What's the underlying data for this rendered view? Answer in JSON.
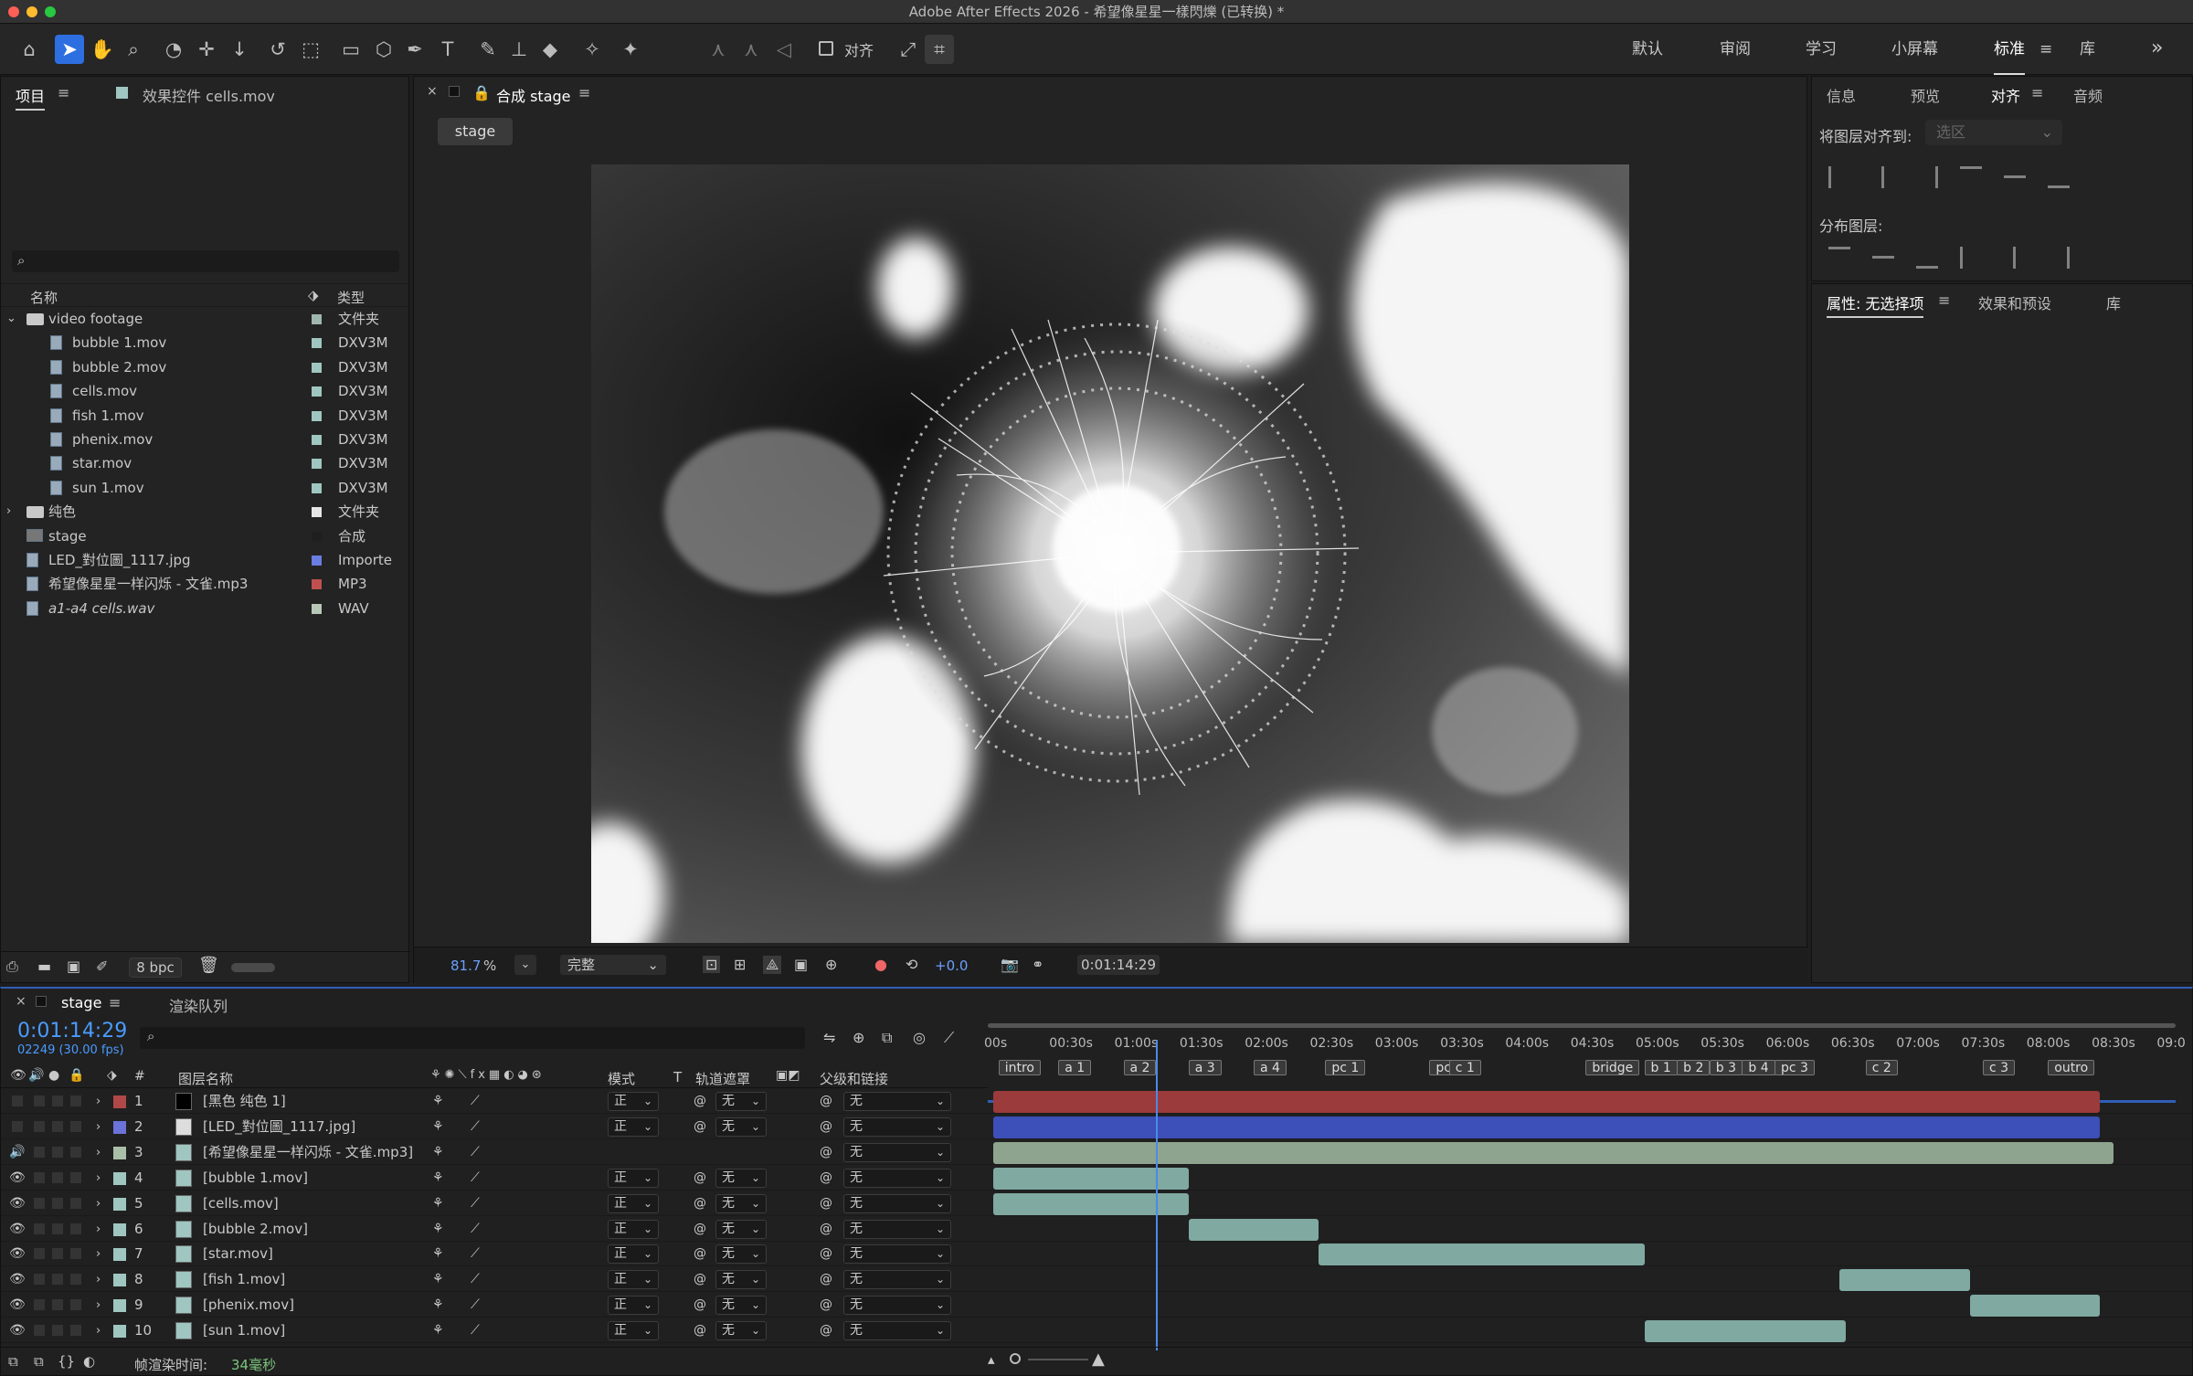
{
  "app": {
    "title": "Adobe After Effects 2026 - 希望像星星一樣閃爍 (已转换) *"
  },
  "toolbar": {
    "snap_label": "对齐"
  },
  "workspaces": [
    {
      "label": "默认"
    },
    {
      "label": "审阅"
    },
    {
      "label": "学习"
    },
    {
      "label": "小屏幕"
    },
    {
      "label": "标准"
    },
    {
      "label": "库"
    }
  ],
  "project": {
    "tab": "项目",
    "effects_tab": "效果控件 cells.mov",
    "col_name": "名称",
    "col_type": "类型",
    "items": [
      {
        "name": "video footage",
        "type": "文件夹",
        "color": "#9fb7b0"
      },
      {
        "name": "bubble 1.mov",
        "type": "DXV3M",
        "color": "#9fc6c0"
      },
      {
        "name": "bubble 2.mov",
        "type": "DXV3M",
        "color": "#9fc6c0"
      },
      {
        "name": "cells.mov",
        "type": "DXV3M",
        "color": "#9fc6c0"
      },
      {
        "name": "fish 1.mov",
        "type": "DXV3M",
        "color": "#9fc6c0"
      },
      {
        "name": "phenix.mov",
        "type": "DXV3M",
        "color": "#9fc6c0"
      },
      {
        "name": "star.mov",
        "type": "DXV3M",
        "color": "#9fc6c0"
      },
      {
        "name": "sun 1.mov",
        "type": "DXV3M",
        "color": "#9fc6c0"
      },
      {
        "name": "纯色",
        "type": "文件夹",
        "color": "#e6e6e6"
      },
      {
        "name": "stage",
        "type": "合成",
        "color": "#1f1f1f"
      },
      {
        "name": "LED_對位圖_1117.jpg",
        "type": "Importe",
        "color": "#6a7de0"
      },
      {
        "name": "希望像星星一样闪烁 - 文雀.mp3",
        "type": "MP3",
        "color": "#c05050"
      },
      {
        "name": "a1-a4 cells.wav",
        "type": "WAV",
        "color": "#b8c8b8"
      }
    ],
    "bpc": "8 bpc"
  },
  "comp": {
    "tab": "合成 stage",
    "breadcrumb": "stage",
    "zoom": "81.7",
    "zoom_unit": "%",
    "resolution": "完整",
    "exposure": "+0.0",
    "timecode": "0:01:14:29"
  },
  "right": {
    "tabs": [
      {
        "label": "信息"
      },
      {
        "label": "预览"
      },
      {
        "label": "对齐"
      },
      {
        "label": "音频"
      }
    ],
    "align_to_label": "将图层对齐到:",
    "align_to_value": "选区",
    "distribute_label": "分布图层:",
    "tabs2": [
      {
        "label": "属性: 无选择项"
      },
      {
        "label": "效果和预设"
      },
      {
        "label": "库"
      }
    ]
  },
  "timeline": {
    "tab": "stage",
    "render_queue": "渲染队列",
    "timecode": "0:01:14:29",
    "frames": "02249 (30.00 fps)",
    "col_hash": "#",
    "col_name": "图层名称",
    "col_mode": "模式",
    "col_t": "T",
    "col_matte": "轨道遮罩",
    "col_parent": "父级和链接",
    "ruler": [
      "00s",
      "00:30s",
      "01:00s",
      "01:30s",
      "02:00s",
      "02:30s",
      "03:00s",
      "03:30s",
      "04:00s",
      "04:30s",
      "05:00s",
      "05:30s",
      "06:00s",
      "06:30s",
      "07:00s",
      "07:30s",
      "08:00s",
      "08:30s",
      "09:0"
    ],
    "markers": [
      {
        "label": "intro",
        "t": 0.04
      },
      {
        "label": "a 1",
        "t": 0.5
      },
      {
        "label": "a 2",
        "t": 1.0
      },
      {
        "label": "a 3",
        "t": 1.5
      },
      {
        "label": "a 4",
        "t": 2.0
      },
      {
        "label": "pc 1",
        "t": 2.55
      },
      {
        "label": "pc 2",
        "t": 3.35
      },
      {
        "label": "c 1",
        "t": 3.5
      },
      {
        "label": "bridge",
        "t": 4.55
      },
      {
        "label": "b 1",
        "t": 5.0
      },
      {
        "label": "b 2",
        "t": 5.25
      },
      {
        "label": "b 3",
        "t": 5.5
      },
      {
        "label": "b 4",
        "t": 5.75
      },
      {
        "label": "pc 3",
        "t": 6.0
      },
      {
        "label": "c 2",
        "t": 6.7
      },
      {
        "label": "c 3",
        "t": 7.6
      },
      {
        "label": "outro",
        "t": 8.1
      }
    ],
    "playhead": 1.25,
    "layers": [
      {
        "num": "1",
        "name": "[黑色 纯色 1]",
        "label": "#b04848",
        "mode": "正",
        "matte": "无",
        "parent": "无",
        "start": 0,
        "end": 8.5,
        "bar": "#9b3b3b"
      },
      {
        "num": "2",
        "name": "[LED_對位圖_1117.jpg]",
        "label": "#6b72d8",
        "mode": "正",
        "matte": "无",
        "parent": "无",
        "start": 0,
        "end": 8.5,
        "bar": "#3d4fb8"
      },
      {
        "num": "3",
        "name": "[希望像星星一样闪烁 - 文雀.mp3]",
        "label": "#a9bfa8",
        "mode": "",
        "matte": "",
        "parent": "无",
        "start": 0,
        "end": 8.6,
        "bar": "#8ea48e"
      },
      {
        "num": "4",
        "name": "[bubble 1.mov]",
        "label": "#9fc6c0",
        "mode": "正",
        "matte": "无",
        "parent": "无",
        "start": 0,
        "end": 1.5,
        "bar": "#7fa9a1"
      },
      {
        "num": "5",
        "name": "[cells.mov]",
        "label": "#9fc6c0",
        "mode": "正",
        "matte": "无",
        "parent": "无",
        "start": 0,
        "end": 1.5,
        "bar": "#7fa9a1"
      },
      {
        "num": "6",
        "name": "[bubble 2.mov]",
        "label": "#9fc6c0",
        "mode": "正",
        "matte": "无",
        "parent": "无",
        "start": 1.5,
        "end": 2.5,
        "bar": "#7fa9a1"
      },
      {
        "num": "7",
        "name": "[star.mov]",
        "label": "#9fc6c0",
        "mode": "正",
        "matte": "无",
        "parent": "无",
        "start": 2.5,
        "end": 5.0,
        "bar": "#7fa9a1"
      },
      {
        "num": "8",
        "name": "[fish 1.mov]",
        "label": "#9fc6c0",
        "mode": "正",
        "matte": "无",
        "parent": "无",
        "start": 6.5,
        "end": 7.5,
        "bar": "#7fa9a1"
      },
      {
        "num": "9",
        "name": "[phenix.mov]",
        "label": "#9fc6c0",
        "mode": "正",
        "matte": "无",
        "parent": "无",
        "start": 7.5,
        "end": 8.5,
        "bar": "#7fa9a1"
      },
      {
        "num": "10",
        "name": "[sun 1.mov]",
        "label": "#9fc6c0",
        "mode": "正",
        "matte": "无",
        "parent": "无",
        "start": 5.0,
        "end": 6.55,
        "bar": "#7fa9a1"
      }
    ],
    "frame_render_label": "帧渲染时间:",
    "frame_render_value": "34毫秒"
  }
}
